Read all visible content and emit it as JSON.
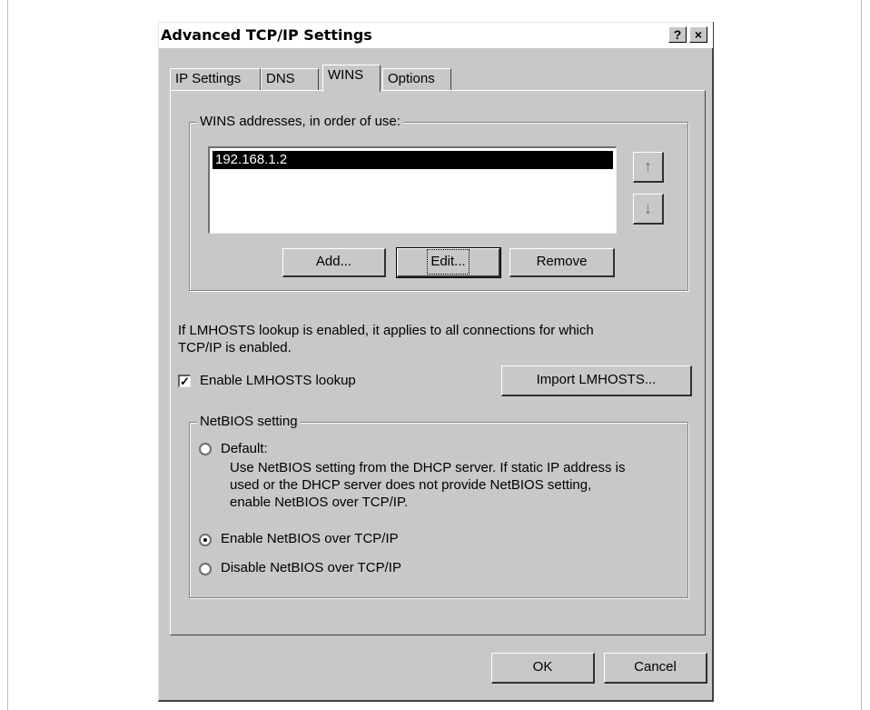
{
  "window": {
    "title": "Advanced TCP/IP Settings",
    "help_label": "?",
    "close_label": "×"
  },
  "tabs": [
    {
      "label": "IP Settings"
    },
    {
      "label": "DNS"
    },
    {
      "label": "WINS"
    },
    {
      "label": "Options"
    }
  ],
  "wins": {
    "group_label": "WINS addresses, in order of use:",
    "addresses": [
      "192.168.1.2"
    ],
    "up_icon": "arrow-up",
    "down_icon": "arrow-down",
    "add_label": "Add...",
    "edit_label": "Edit...",
    "remove_label": "Remove"
  },
  "lmhosts": {
    "info_line1": "If LMHOSTS lookup is enabled, it applies to all connections for which",
    "info_line2": "TCP/IP is enabled.",
    "checkbox_label": "Enable LMHOSTS lookup",
    "checked": true,
    "import_label": "Import LMHOSTS..."
  },
  "netbios": {
    "group_label": "NetBIOS setting",
    "default_label": "Default:",
    "default_desc_line1": "Use NetBIOS setting from the DHCP server. If static IP address is",
    "default_desc_line2": "used or the DHCP server does not provide NetBIOS setting,",
    "default_desc_line3": "enable NetBIOS over TCP/IP.",
    "enable_label": "Enable NetBIOS over TCP/IP",
    "disable_label": "Disable NetBIOS over TCP/IP",
    "selected": "enable"
  },
  "footer": {
    "ok_label": "OK",
    "cancel_label": "Cancel"
  }
}
